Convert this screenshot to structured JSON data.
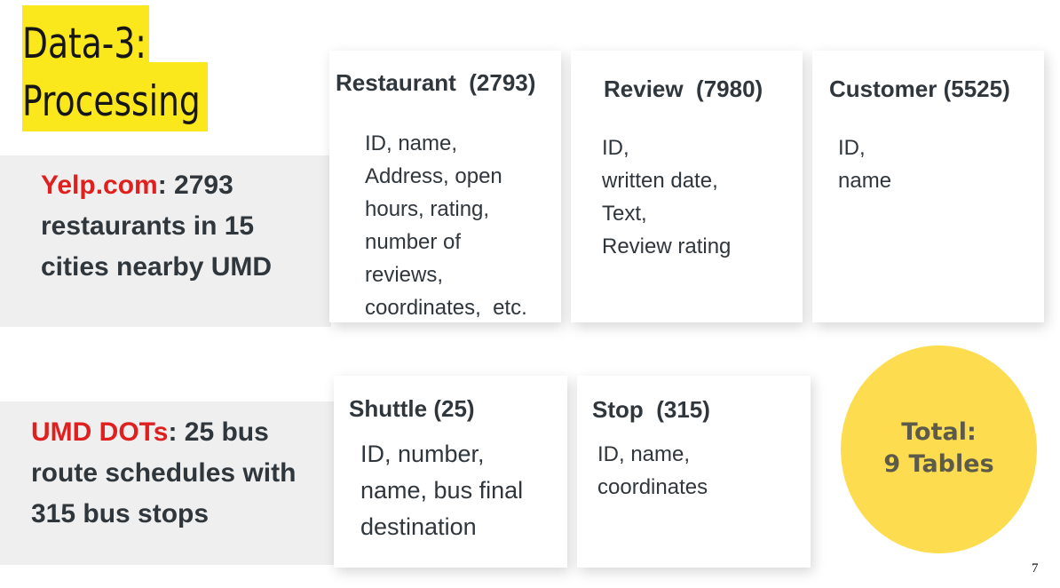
{
  "title": {
    "line1": "Data-3:",
    "line2": "Processing",
    "highlight_color": "#fbe81c"
  },
  "sources": [
    {
      "name": "Yelp.com",
      "lines": [
        ": 2793",
        "restaurants in 15",
        "cities nearby UMD"
      ]
    },
    {
      "name": "UMD DOTs",
      "lines": [
        ": 25 bus",
        "route schedules with",
        "315 bus stops"
      ]
    }
  ],
  "tables": {
    "restaurant": {
      "title": "Restaurant  (2793)",
      "fields": [
        "ID, name,",
        "Address, open",
        "hours, rating,",
        "number of",
        "reviews,",
        "coordinates,  etc."
      ]
    },
    "review": {
      "title": "Review  (7980)",
      "fields": [
        "ID,",
        "written date,",
        "Text,",
        "Review rating"
      ]
    },
    "customer": {
      "title": "Customer (5525)",
      "fields": [
        "ID,",
        "name"
      ]
    },
    "shuttle": {
      "title": "Shuttle (25)",
      "fields": [
        "ID, number,",
        "name, bus final",
        "destination"
      ]
    },
    "stop": {
      "title": "Stop  (315)",
      "fields": [
        "ID, name,",
        "coordinates"
      ]
    }
  },
  "total": {
    "line1": "Total:",
    "line2": "9 Tables",
    "circle_color": "#fddd4f"
  },
  "slide_number": "7",
  "colors": {
    "source_name": "#e01f1f",
    "panel_background": "#efefef",
    "text": "#2f363c"
  }
}
